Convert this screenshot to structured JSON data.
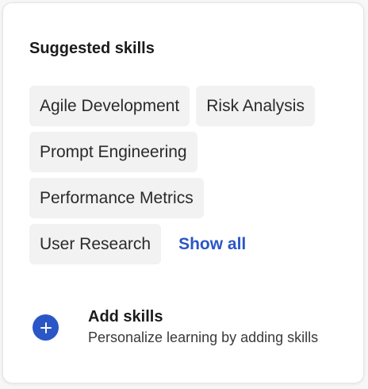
{
  "header": {
    "title": "Suggested skills"
  },
  "skills": {
    "row1": [
      "Agile Development",
      "Risk Analysis"
    ],
    "row2": [
      "Prompt Engineering"
    ],
    "row3": [
      "Performance Metrics"
    ],
    "row4": [
      "User Research"
    ]
  },
  "show_all_label": "Show all",
  "add_skills": {
    "title": "Add skills",
    "subtitle": "Personalize learning by adding skills",
    "icon": "plus-icon"
  },
  "colors": {
    "accent": "#2b56c5",
    "chip_bg": "#f2f2f2"
  }
}
